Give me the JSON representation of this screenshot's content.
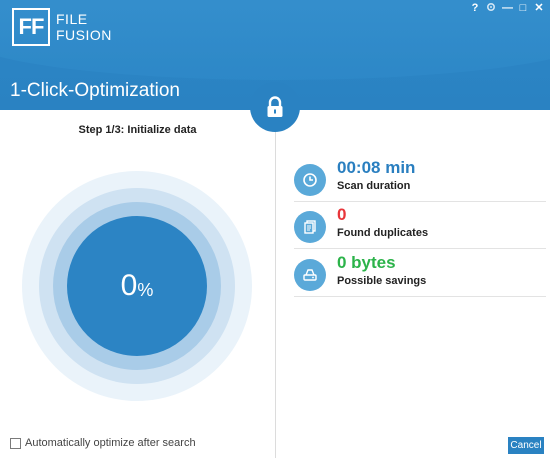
{
  "app": {
    "logo_mark": "FF",
    "logo_line1": "FILE",
    "logo_line2": "FUSION",
    "title": "1-Click-Optimization"
  },
  "window_controls": {
    "help": "?",
    "settings_icon": "gear-icon",
    "minimize": "—",
    "maximize": "□",
    "close": "✕"
  },
  "step": {
    "label": "Step 1/3: Initialize data"
  },
  "progress": {
    "value": "0",
    "unit": "%"
  },
  "stats": [
    {
      "icon": "clock-icon",
      "value": "00:08 min",
      "label": "Scan duration",
      "color": "#2a7fc0"
    },
    {
      "icon": "files-icon",
      "value": "0",
      "label": "Found duplicates",
      "color": "#e8353a"
    },
    {
      "icon": "drive-icon",
      "value": "0 bytes",
      "label": "Possible savings",
      "color": "#2cb34a"
    }
  ],
  "footer": {
    "auto_optimize_label": "Automatically optimize after search",
    "auto_optimize_checked": false,
    "cancel_label": "Cancel"
  },
  "colors": {
    "accent": "#2a82c2",
    "icon_bg": "#5aa9d9"
  }
}
